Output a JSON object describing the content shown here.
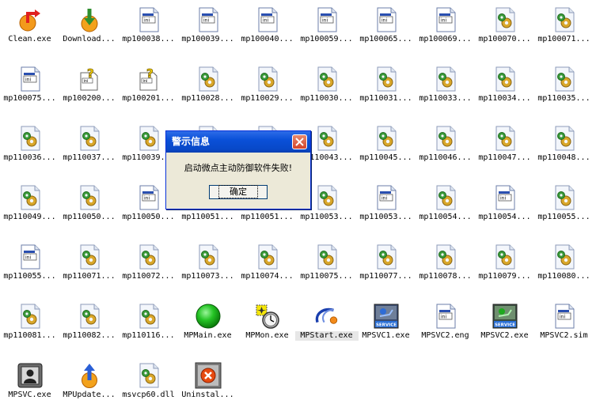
{
  "files": [
    {
      "label": "Clean.exe",
      "icon": "clean-exe-icon",
      "type": "clean"
    },
    {
      "label": "Download...",
      "icon": "download-exe-icon",
      "type": "download"
    },
    {
      "label": "mp100038...",
      "icon": "ini-file-icon",
      "type": "ini"
    },
    {
      "label": "mp100039...",
      "icon": "ini-file-icon",
      "type": "ini"
    },
    {
      "label": "mp100040...",
      "icon": "ini-file-icon",
      "type": "ini"
    },
    {
      "label": "mp100059...",
      "icon": "ini-file-icon",
      "type": "ini"
    },
    {
      "label": "mp100065...",
      "icon": "ini-file-icon",
      "type": "ini"
    },
    {
      "label": "mp100069...",
      "icon": "ini-file-icon",
      "type": "ini"
    },
    {
      "label": "mp100070...",
      "icon": "dll-file-icon",
      "type": "dll"
    },
    {
      "label": "mp100071...",
      "icon": "dll-file-icon",
      "type": "dll"
    },
    {
      "label": "mp100075...",
      "icon": "ini-file-icon",
      "type": "ini"
    },
    {
      "label": "mp100200...",
      "icon": "help-file-icon",
      "type": "help"
    },
    {
      "label": "mp100201...",
      "icon": "help-file-icon",
      "type": "help"
    },
    {
      "label": "mp110028...",
      "icon": "dll-file-icon",
      "type": "dll"
    },
    {
      "label": "mp110029...",
      "icon": "dll-file-icon",
      "type": "dll"
    },
    {
      "label": "mp110030...",
      "icon": "dll-file-icon",
      "type": "dll"
    },
    {
      "label": "mp110031...",
      "icon": "dll-file-icon",
      "type": "dll"
    },
    {
      "label": "mp110033...",
      "icon": "dll-file-icon",
      "type": "dll"
    },
    {
      "label": "mp110034...",
      "icon": "dll-file-icon",
      "type": "dll"
    },
    {
      "label": "mp110035...",
      "icon": "dll-file-icon",
      "type": "dll"
    },
    {
      "label": "mp110036...",
      "icon": "dll-file-icon",
      "type": "dll"
    },
    {
      "label": "mp110037...",
      "icon": "dll-file-icon",
      "type": "dll"
    },
    {
      "label": "mp110039...",
      "icon": "dll-file-icon",
      "type": "dll"
    },
    {
      "label": "",
      "icon": "dll-file-icon",
      "type": "hidden"
    },
    {
      "label": "",
      "icon": "dll-file-icon",
      "type": "hidden"
    },
    {
      "label": "mp110043...",
      "icon": "dll-file-icon",
      "type": "dll"
    },
    {
      "label": "mp110045...",
      "icon": "dll-file-icon",
      "type": "dll"
    },
    {
      "label": "mp110046...",
      "icon": "dll-file-icon",
      "type": "dll"
    },
    {
      "label": "mp110047...",
      "icon": "dll-file-icon",
      "type": "dll"
    },
    {
      "label": "mp110048...",
      "icon": "dll-file-icon",
      "type": "dll"
    },
    {
      "label": "mp110049...",
      "icon": "dll-file-icon",
      "type": "dll"
    },
    {
      "label": "mp110050...",
      "icon": "dll-file-icon",
      "type": "dll"
    },
    {
      "label": "mp110050...",
      "icon": "ini-file-icon",
      "type": "ini"
    },
    {
      "label": "mp110051...",
      "icon": "dll-file-icon",
      "type": "dll"
    },
    {
      "label": "mp110051...",
      "icon": "dll-file-icon",
      "type": "dll"
    },
    {
      "label": "mp110053...",
      "icon": "dll-file-icon",
      "type": "dll"
    },
    {
      "label": "mp110053...",
      "icon": "ini-file-icon",
      "type": "ini"
    },
    {
      "label": "mp110054...",
      "icon": "dll-file-icon",
      "type": "dll"
    },
    {
      "label": "mp110054...",
      "icon": "ini-file-icon",
      "type": "ini"
    },
    {
      "label": "mp110055...",
      "icon": "dll-file-icon",
      "type": "dll"
    },
    {
      "label": "mp110055...",
      "icon": "ini-file-icon",
      "type": "ini"
    },
    {
      "label": "mp110071...",
      "icon": "dll-file-icon",
      "type": "dll"
    },
    {
      "label": "mp110072...",
      "icon": "dll-file-icon",
      "type": "dll"
    },
    {
      "label": "mp110073...",
      "icon": "dll-file-icon",
      "type": "dll"
    },
    {
      "label": "mp110074...",
      "icon": "dll-file-icon",
      "type": "dll"
    },
    {
      "label": "mp110075...",
      "icon": "dll-file-icon",
      "type": "dll"
    },
    {
      "label": "mp110077...",
      "icon": "dll-file-icon",
      "type": "dll"
    },
    {
      "label": "mp110078...",
      "icon": "dll-file-icon",
      "type": "dll"
    },
    {
      "label": "mp110079...",
      "icon": "dll-file-icon",
      "type": "dll"
    },
    {
      "label": "mp110080...",
      "icon": "dll-file-icon",
      "type": "dll"
    },
    {
      "label": "mp110081...",
      "icon": "dll-file-icon",
      "type": "dll"
    },
    {
      "label": "mp110082...",
      "icon": "dll-file-icon",
      "type": "dll"
    },
    {
      "label": "mp110116...",
      "icon": "dll-file-icon",
      "type": "dll"
    },
    {
      "label": "MPMain.exe",
      "icon": "mpmain-green-orb-icon",
      "type": "orb"
    },
    {
      "label": "MPMon.exe",
      "icon": "mpmon-clock-icon",
      "type": "clock"
    },
    {
      "label": "MPStart.exe",
      "icon": "mpstart-logo-icon",
      "type": "start",
      "selected": true
    },
    {
      "label": "MPSVC1.exe",
      "icon": "service-icon",
      "type": "service"
    },
    {
      "label": "MPSVC2.eng",
      "icon": "ini-file-icon",
      "type": "ini"
    },
    {
      "label": "MPSVC2.exe",
      "icon": "service-green-icon",
      "type": "service2"
    },
    {
      "label": "MPSVC2.sim",
      "icon": "ini-file-icon",
      "type": "ini"
    },
    {
      "label": "MPSVC.exe",
      "icon": "mpsvc-user-icon",
      "type": "user"
    },
    {
      "label": "MPUpdate...",
      "icon": "mpupdate-icon",
      "type": "update"
    },
    {
      "label": "msvcp60.dll",
      "icon": "dll-file-icon",
      "type": "dll"
    },
    {
      "label": "Uninstal...",
      "icon": "uninstall-icon",
      "type": "uninstall"
    }
  ],
  "dialog": {
    "title": "警示信息",
    "message": "启动微点主动防御软件失败!",
    "ok_label": "确定"
  }
}
